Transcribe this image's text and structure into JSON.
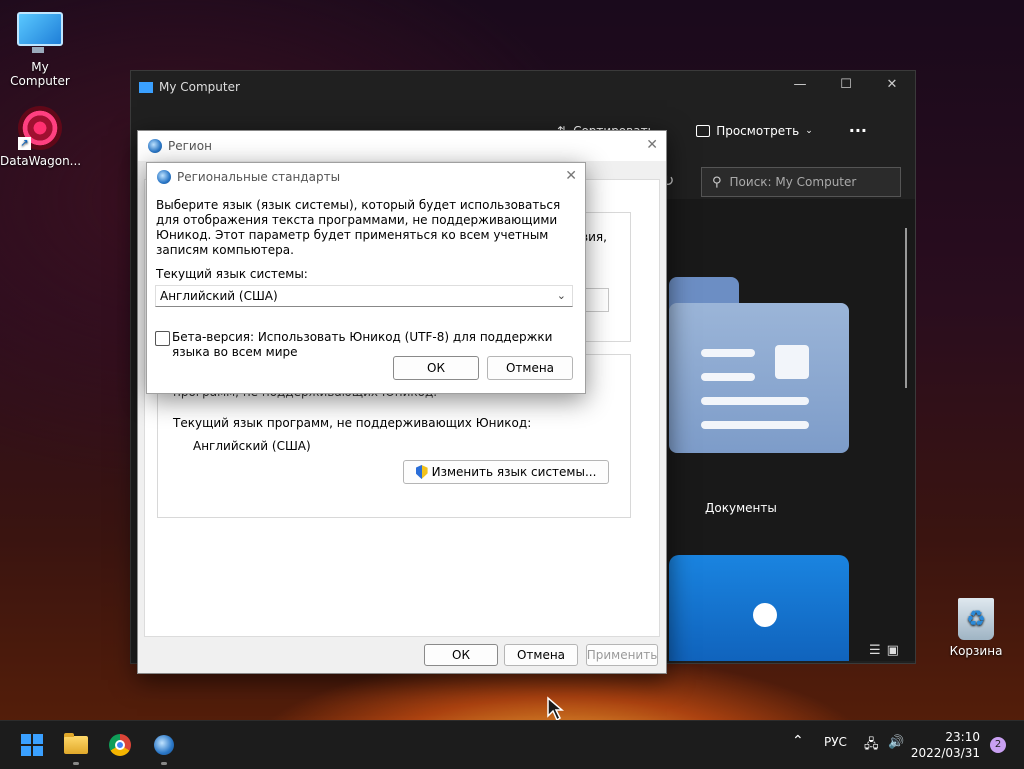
{
  "desktop": {
    "icons": [
      {
        "label": "My Computer"
      },
      {
        "label": "DataWagon..."
      },
      {
        "label": "Корзина"
      }
    ]
  },
  "explorer": {
    "title": "My Computer",
    "toolbar": {
      "sort_label": "Сортировать",
      "view_label": "Просмотреть",
      "more_label": "···"
    },
    "search_placeholder": "Поиск: My Computer",
    "folder_label": "Документы",
    "controls": {
      "minimize": "—",
      "maximize": "☐",
      "close": "✕"
    }
  },
  "region_dialog": {
    "title": "Регион",
    "partial_text_right": "вия,",
    "partial_text_top": "программ, не поддерживающих Юникод.",
    "current_lang_label": "Текущий язык программ, не поддерживающих Юникод:",
    "current_lang_value": "Английский (США)",
    "change_system_lang_button": "Изменить язык системы...",
    "ok_button": "ОК",
    "cancel_button": "Отмена",
    "apply_button": "Применить"
  },
  "regional_standards_dialog": {
    "title": "Региональные стандарты",
    "description": "Выберите язык (язык системы), который будет использоваться для отображения текста программами, не поддерживающими Юникод. Этот параметр будет применяться ко всем учетным записям компьютера.",
    "current_system_lang_label": "Текущий язык системы:",
    "current_system_lang_value": "Английский (США)",
    "beta_checkbox_label": "Бета-версия: Использовать Юникод (UTF-8) для поддержки языка во всем мире",
    "beta_checked": false,
    "ok_button": "ОК",
    "cancel_button": "Отмена"
  },
  "taskbar": {
    "language": "РУС",
    "time": "23:10",
    "date": "2022/03/31",
    "notifications": "2"
  }
}
